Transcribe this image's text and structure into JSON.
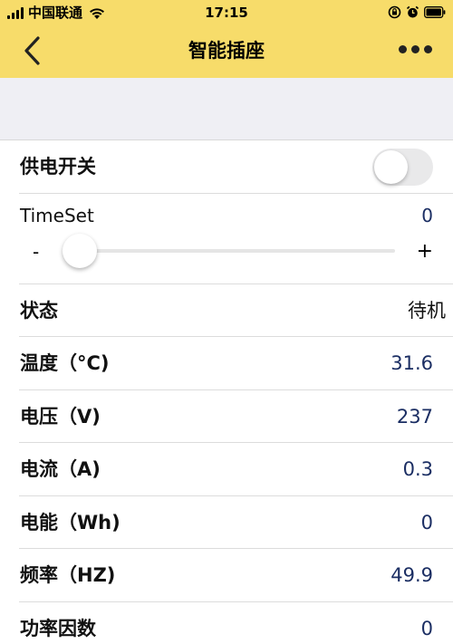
{
  "status_bar": {
    "carrier": "中国联通",
    "time": "17:15"
  },
  "nav": {
    "title": "智能插座"
  },
  "power_switch": {
    "label": "供电开关",
    "on": false
  },
  "timeset": {
    "label": "TimeSet",
    "value": "0",
    "min_label": "-",
    "max_label": "+",
    "slider_fraction": 0
  },
  "rows": [
    {
      "label": "状态",
      "value": "待机"
    },
    {
      "label": "温度（°C)",
      "value": "31.6"
    },
    {
      "label": "电压（V)",
      "value": "237"
    },
    {
      "label": "电流（A)",
      "value": "0.3"
    },
    {
      "label": "电能（Wh)",
      "value": "0"
    },
    {
      "label": "频率（HZ)",
      "value": "49.9"
    },
    {
      "label": "功率因数",
      "value": "0"
    }
  ],
  "colors": {
    "header_bg": "#f7dc6a",
    "value_text": "#1b2e63",
    "spacer_bg": "#efeff4"
  }
}
